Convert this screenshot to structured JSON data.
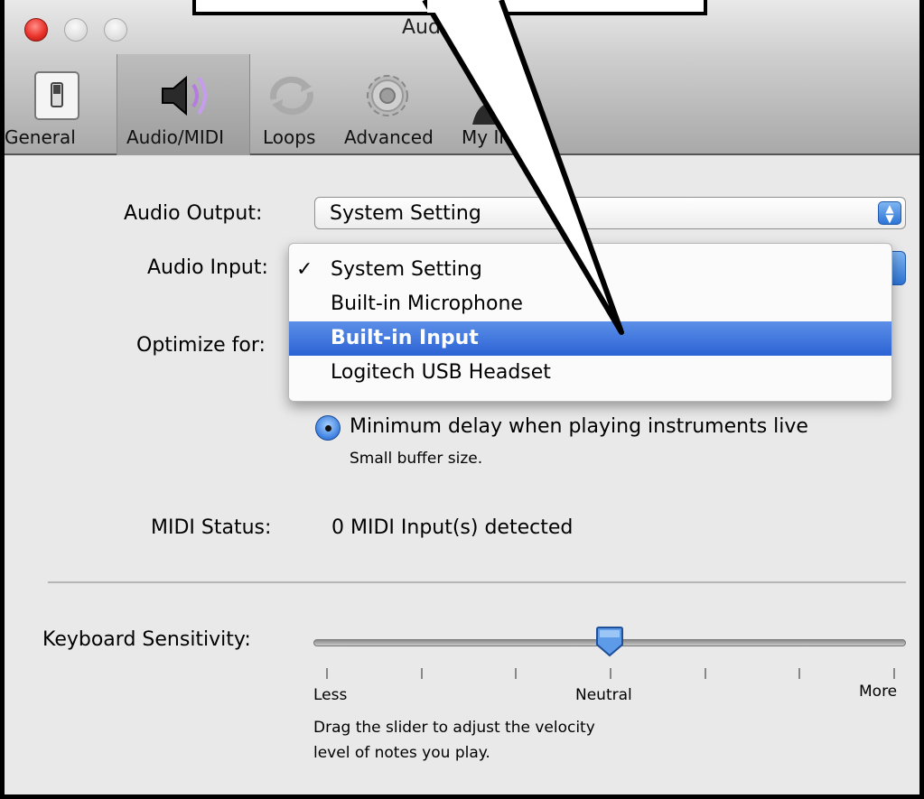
{
  "window": {
    "title": "Audio/MIDI"
  },
  "toolbar": {
    "items": [
      {
        "label": "General",
        "icon": "switch-icon"
      },
      {
        "label": "Audio/MIDI",
        "icon": "speaker-icon"
      },
      {
        "label": "Loops",
        "icon": "loop-arrows-icon"
      },
      {
        "label": "Advanced",
        "icon": "gear-icon"
      },
      {
        "label": "My Info",
        "icon": "person-icon"
      }
    ],
    "selected": "Audio/MIDI"
  },
  "audio_output": {
    "label": "Audio Output:",
    "value": "System Setting"
  },
  "audio_input": {
    "label": "Audio Input:",
    "options": [
      {
        "label": "System Setting",
        "checked": true
      },
      {
        "label": "Built-in Microphone",
        "checked": false
      },
      {
        "label": "Built-in Input",
        "checked": false,
        "highlighted": true
      },
      {
        "label": "Logitech USB Headset",
        "checked": false
      }
    ],
    "check_mark": "✓"
  },
  "optimize": {
    "label": "Optimize for:",
    "radio_label": "Minimum delay when playing instruments live",
    "radio_note": "Small buffer size."
  },
  "midi": {
    "label": "MIDI Status:",
    "value": "0 MIDI Input(s) detected"
  },
  "keyboard": {
    "label": "Keyboard Sensitivity:",
    "min_label": "Less",
    "mid_label": "Neutral",
    "max_label": "More",
    "value_fraction": 0.5,
    "tick_count": 7,
    "help_line1": "Drag the slider to adjust the velocity",
    "help_line2": "level of notes you play."
  },
  "colors": {
    "highlight": "#2c63d4",
    "accent": "#3b7fe0"
  }
}
